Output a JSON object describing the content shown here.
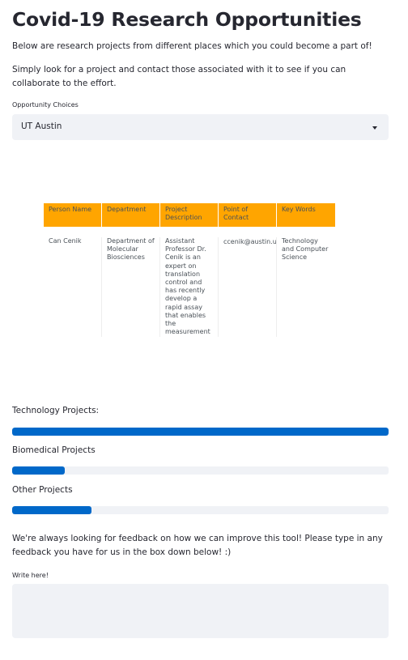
{
  "header": {
    "title": "Covid-19 Research Opportunities",
    "intro_1": "Below are research projects from different places which you could become a part of!",
    "intro_2": "Simply look for a project and contact those associated with it to see if you can collaborate to the effort."
  },
  "selector": {
    "label": "Opportunity Choices",
    "selected": "UT Austin",
    "icon": "chevron-down-icon"
  },
  "table": {
    "columns": [
      "Person Name",
      "Department",
      "Project Description",
      "Point of Contact",
      "Key Words"
    ],
    "rows": [
      [
        "Can Cenik",
        "Department of Molecular Biosciences",
        "Assistant Professor Dr. Cenik is an expert on translation control and has recently develop a rapid assay that enables the measurement of translation",
        "ccenik@austin.utexas.edu",
        "Technology and Computer Science"
      ]
    ],
    "header_color": "#ffa500"
  },
  "progress": {
    "technology": {
      "label": "Technology Projects:",
      "value": 1.0
    },
    "biomedical": {
      "label": "Biomedical Projects",
      "value": 0.14
    },
    "other": {
      "label": "Other Projects",
      "value": 0.21
    },
    "fill_color": "#0068c9"
  },
  "feedback": {
    "prompt": "We're always looking for feedback on how we can improve this tool! Please type in any feedback you have for us in the box down below! :)",
    "label": "Write here!",
    "value": ""
  }
}
